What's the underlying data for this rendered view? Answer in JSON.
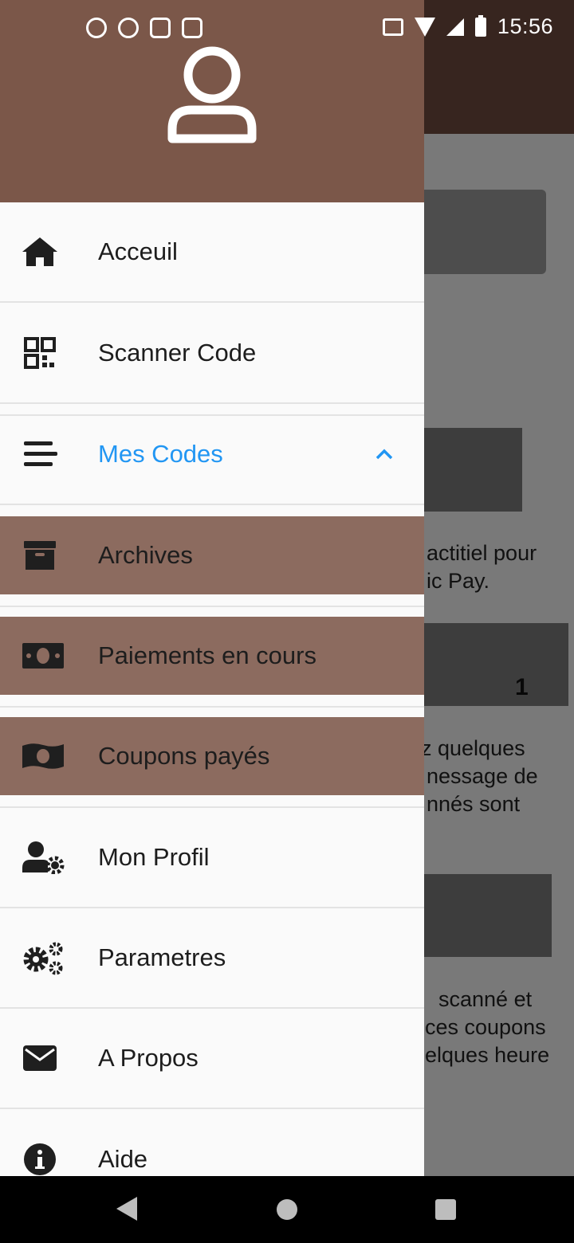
{
  "status_bar": {
    "time": "15:56",
    "left_icons": [
      "notification-c-icon",
      "notification-plus-icon",
      "notification-sync-icon",
      "notification-shield-icon"
    ],
    "right_icons": [
      "vibrate-icon",
      "wifi-icon",
      "signal-icon",
      "battery-charging-icon"
    ]
  },
  "drawer": {
    "header_icon": "user-avatar-icon",
    "header_color": "#7b5749",
    "items": [
      {
        "label": "Acceuil",
        "icon": "home-icon"
      },
      {
        "label": "Scanner Code",
        "icon": "qr-code-icon"
      },
      {
        "label": "Mes Codes",
        "icon": "list-icon",
        "expanded": true,
        "accent": "#2196f3"
      },
      {
        "label": "Archives",
        "icon": "archive-box-icon",
        "selected_style": true
      },
      {
        "label": "Paiements en cours",
        "icon": "money-bill-icon",
        "selected_style": true
      },
      {
        "label": "Coupons payés",
        "icon": "money-bill-wave-icon",
        "selected_style": true
      },
      {
        "label": "Mon Profil",
        "icon": "user-cog-icon"
      },
      {
        "label": "Parametres",
        "icon": "cogs-icon"
      },
      {
        "label": "A Propos",
        "icon": "envelope-icon"
      },
      {
        "label": "Aide",
        "icon": "info-circle-icon"
      }
    ]
  },
  "background": {
    "text_1": [
      "actitiel  pour",
      "ic Pay."
    ],
    "number_1": "1",
    "text_2": [
      "z    quelques",
      "nessage   de",
      "nnés      sont"
    ],
    "text_3": [
      "scanné    et",
      "ces coupons",
      "elques  heure"
    ]
  },
  "nav_bar": {
    "buttons": [
      "back-icon",
      "home-circle-icon",
      "recents-icon"
    ]
  }
}
